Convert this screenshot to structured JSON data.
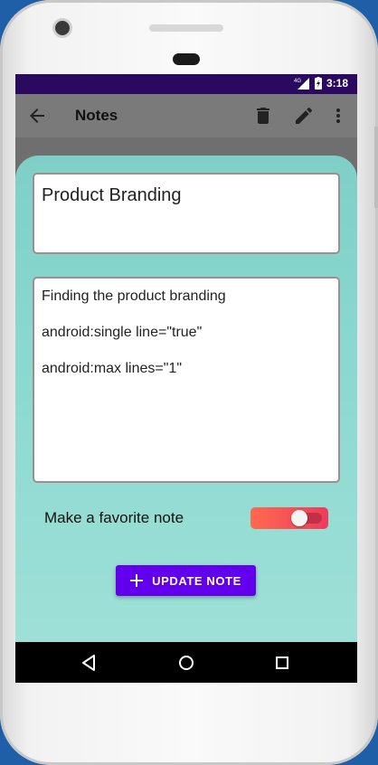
{
  "status_bar": {
    "network": "4G",
    "time": "3:18"
  },
  "toolbar": {
    "title": "Notes"
  },
  "note": {
    "title": "Product Branding",
    "body": "Finding the product branding\n\nandroid:single line=\"true\"\n\nandroid:max lines=\"1\""
  },
  "favorite": {
    "label": "Make a favorite note",
    "enabled": true
  },
  "update_button": {
    "label": "UPDATE NOTE"
  },
  "colors": {
    "accent": "#6200ee",
    "status_bar": "#2a0a5e",
    "sheet": "#8ad8cf",
    "switch": "#ee3b5c"
  },
  "icons": [
    "back-arrow-icon",
    "delete-icon",
    "edit-icon",
    "more-vert-icon",
    "plus-icon",
    "nav-back-icon",
    "nav-home-icon",
    "nav-recents-icon"
  ]
}
